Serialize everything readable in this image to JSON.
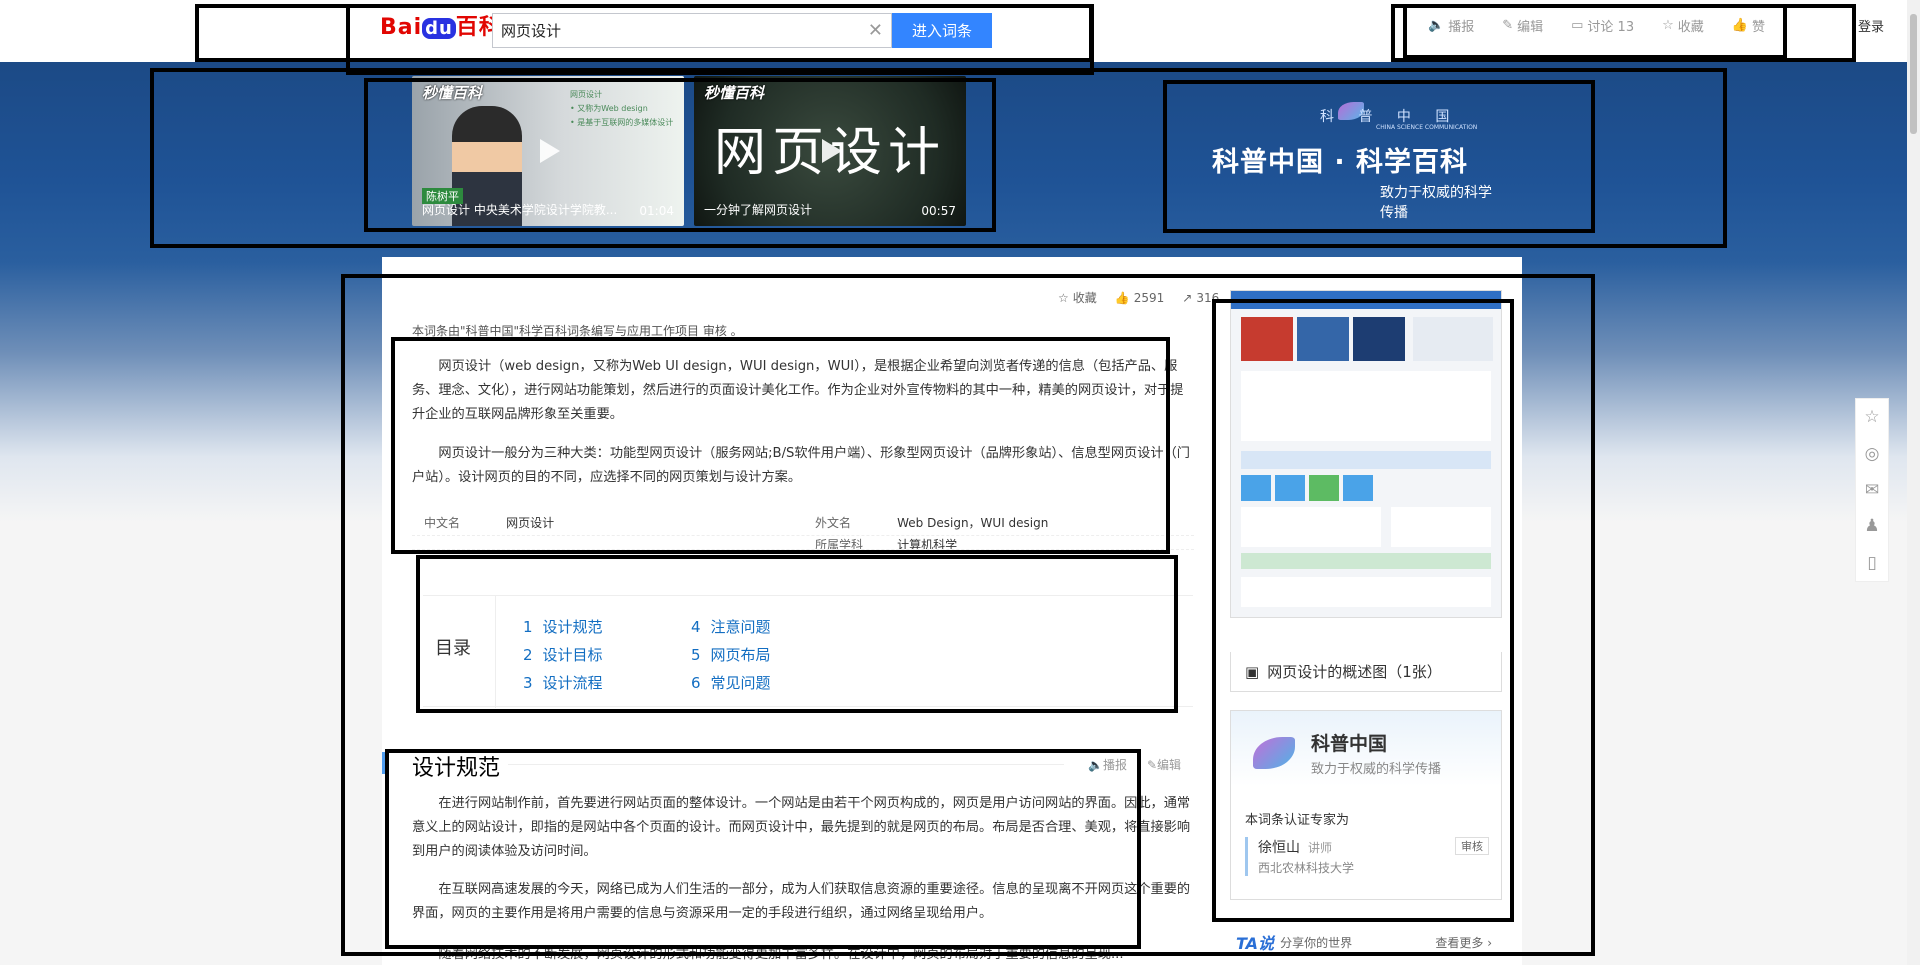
{
  "header": {
    "logo_text_a": "Bai",
    "logo_text_b": "du",
    "logo_text_c": "百科",
    "search_value": "网页设计",
    "search_clear": "✕",
    "enter_label": "进入词条",
    "actions": [
      {
        "icon": "speaker-icon",
        "glyph": "🔈",
        "label": "播报"
      },
      {
        "icon": "edit-icon",
        "glyph": "✎",
        "label": "编辑"
      },
      {
        "icon": "discuss-icon",
        "glyph": "▭",
        "label": "讨论 13"
      },
      {
        "icon": "star-icon",
        "glyph": "☆",
        "label": "收藏"
      },
      {
        "icon": "thumb-up-icon",
        "glyph": "👍",
        "label": "赞"
      }
    ],
    "login": "登录"
  },
  "banner": {
    "video1": {
      "brand": "秒懂百科",
      "presenter": "陈树平",
      "caption": "网页设计 中央美术学院设计学院教...",
      "duration": "01:04",
      "slide_title": "网页设计",
      "slide_lines": [
        "• 又称为Web design",
        "• 是基于互联网的多媒体设计"
      ]
    },
    "video2": {
      "brand": "秒懂百科",
      "title": "网页设计",
      "caption": "一分钟了解网页设计",
      "duration": "00:57"
    },
    "kepu": {
      "cn": "科 普 中 国",
      "en": "CHINA SCIENCE COMMUNICATION",
      "title": "科普中国 · 科学百科",
      "subtitle": "致力于权威的科学传播"
    }
  },
  "article": {
    "like_bar": [
      {
        "icon": "star-icon",
        "glyph": "☆",
        "label": "收藏"
      },
      {
        "icon": "thumb-up-icon",
        "glyph": "👍",
        "label": "2591"
      },
      {
        "icon": "share-icon",
        "glyph": "↗",
        "label": "316"
      }
    ],
    "audit": "本词条由\"科普中国\"科学百科词条编写与应用工作项目 审核 。",
    "p1": "网页设计（web design，又称为Web UI design，WUI design，WUI），是根据企业希望向浏览者传递的信息（包括产品、服务、理念、文化），进行网站功能策划，然后进行的页面设计美化工作。作为企业对外宣传物料的其中一种，精美的网页设计，对于提升企业的互联网品牌形象至关重要。",
    "p2": "网页设计一般分为三种大类：功能型网页设计（服务网站;B/S软件用户端）、形象型网页设计（品牌形象站）、信息型网页设计（门户站）。设计网页的目的不同，应选择不同的网页策划与设计方案。",
    "basic_info": [
      {
        "k1": "中文名",
        "v1": "网页设计",
        "k2": "外文名",
        "v2": "Web Design，WUI design"
      },
      {
        "k1": "",
        "v1": "",
        "k2": "所属学科",
        "v2": "计算机科学"
      }
    ],
    "toc_label": "目录",
    "toc_left": [
      {
        "num": "1",
        "label": "设计规范"
      },
      {
        "num": "2",
        "label": "设计目标"
      },
      {
        "num": "3",
        "label": "设计流程"
      }
    ],
    "toc_right": [
      {
        "num": "4",
        "label": "注意问题"
      },
      {
        "num": "5",
        "label": "网页布局"
      },
      {
        "num": "6",
        "label": "常见问题"
      }
    ],
    "section1_title": "设计规范",
    "section1_actions": [
      {
        "icon": "speaker-icon",
        "glyph": "🔈",
        "label": "播报"
      },
      {
        "icon": "edit-icon",
        "glyph": "✎",
        "label": "编辑"
      }
    ],
    "p3": "在进行网站制作前，首先要进行网站页面的整体设计。一个网站是由若干个网页构成的，网页是用户访问网站的界面。因此，通常意义上的网站设计，即指的是网站中各个页面的设计。而网页设计中，最先提到的就是网页的布局。布局是否合理、美观，将直接影响到用户的阅读体验及访问时间。",
    "p4": "在互联网高速发展的今天，网络已成为人们生活的一部分，成为人们获取信息资源的重要途径。信息的呈现离不开网页这个重要的界面，网页的主要作用是将用户需要的信息与资源采用一定的手段进行组织，通过网络呈现给用户。",
    "p5": "随着网络技术的不断发展，网页设计的形式和功能变得更加丰富多样。在设计中，网页的布局对于重要的信息的呈现..."
  },
  "sidebar": {
    "image_caption": "网页设计的概述图（1张）",
    "kepu_name": "科普中国",
    "kepu_sub": "致力于权威的科学传播",
    "cert_label": "本词条认证专家为",
    "expert_name": "徐恒山",
    "expert_title": "讲师",
    "expert_org": "西北农林科技大学",
    "review_label": "审核",
    "ta_logo": "TA说",
    "ta_slogan": "分享你的世界",
    "ta_more": "查看更多 ›"
  },
  "floatbar": [
    "☆",
    "◎",
    "✉",
    "♟",
    "▯"
  ],
  "colors": {
    "accent": "#3385ff",
    "link": "#136ec2",
    "banner": "#1f5396"
  }
}
